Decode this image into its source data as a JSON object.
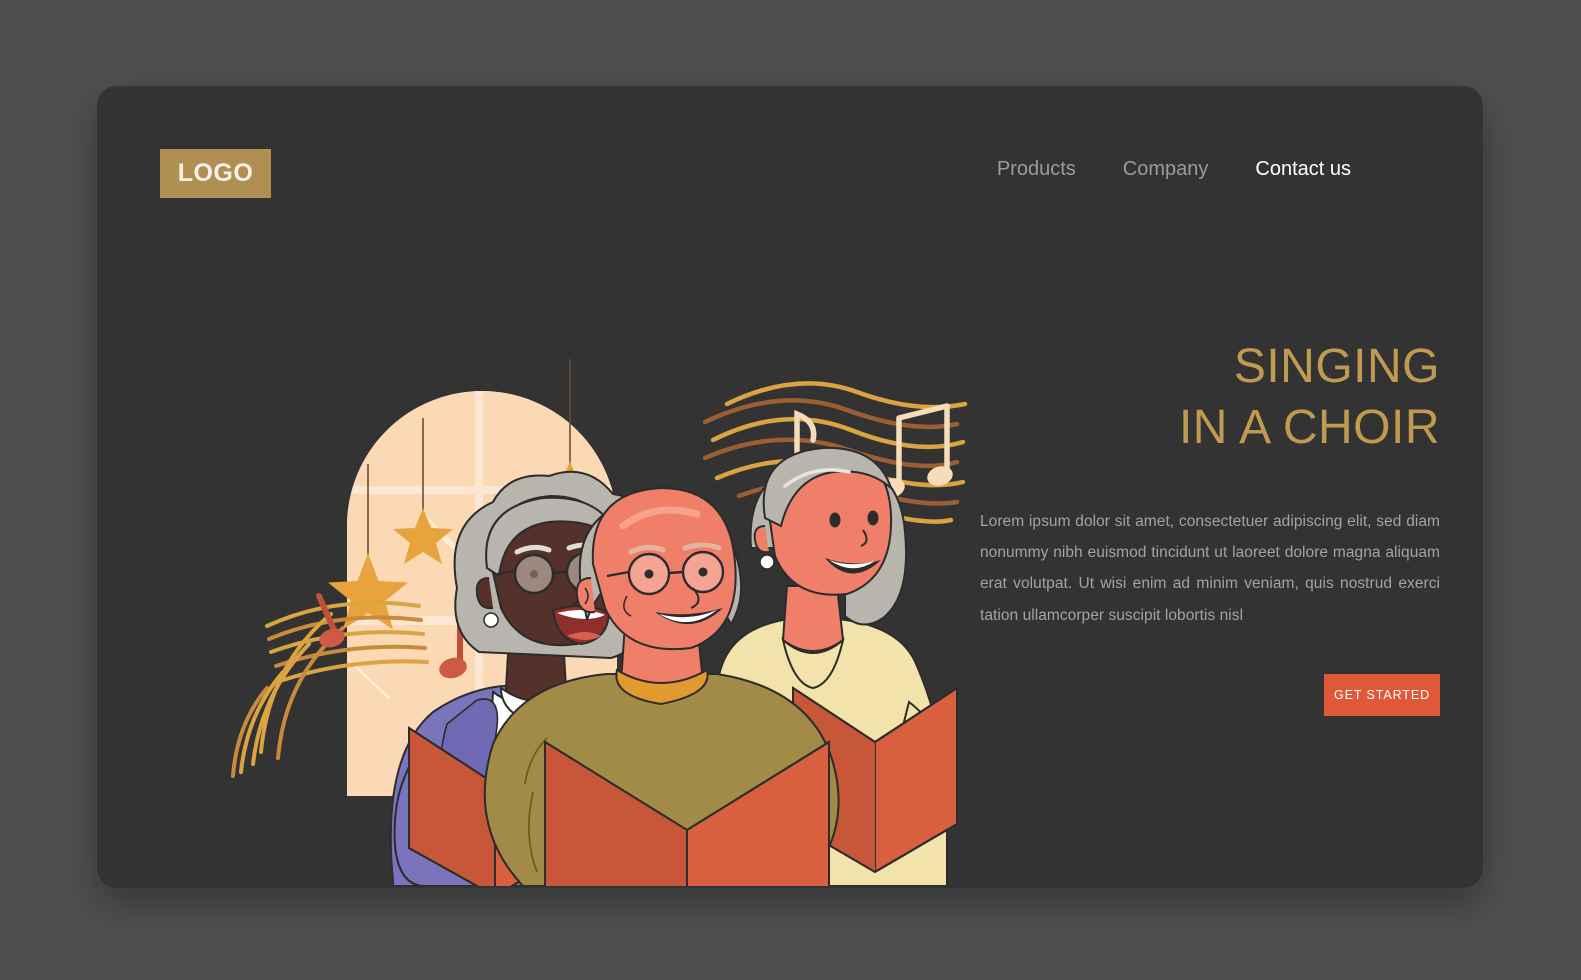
{
  "page": {
    "background_color": "#4f4f4f",
    "card_color": "#333333"
  },
  "navbar": {
    "logo_label": "LOGO",
    "logo_bg_color": "#b18f53",
    "links": [
      {
        "label": "Products",
        "active": false
      },
      {
        "label": "Company",
        "active": false
      },
      {
        "label": "Contact us",
        "active": true
      }
    ]
  },
  "hero": {
    "headline_line1": "SINGING",
    "headline_line2": "IN A CHOIR",
    "headline_color": "#c19a52",
    "paragraph": "Lorem ipsum dolor sit amet, consectetuer adipiscing elit, sed diam nonummy nibh euismod tincidunt ut laoreet dolore magna aliquam erat volutpat. Ut wisi enim ad minim veniam, quis nostrud exerci tation ullamcorper suscipit lobortis nisl",
    "paragraph_color": "#a3a3a3",
    "cta_label": "GET STARTED",
    "cta_color": "#e0583a"
  },
  "illustration": {
    "name": "choir-singers-illustration",
    "description": "Three elderly people singing from orange song books in front of an arched window with hanging stars, with musical notes floating around",
    "colors": {
      "window_glass": "#fbd9b4",
      "window_frame": "#fbe7d2",
      "star": "#e8a33d",
      "book": "#d9603f",
      "book_inner": "#c75738",
      "sweater_olive": "#a18b47",
      "cardigan_purple": "#7a74bd",
      "blouse_cream": "#f1e3a9",
      "skin_light": "#f07f69",
      "skin_dark": "#54312a",
      "hair_gray": "#b8b5ae",
      "note_line_gold": "#d9a441",
      "note_line_brown": "#9c5f33",
      "note_head_cream": "#f5ddb9",
      "note_head_red": "#cf5a43"
    }
  }
}
